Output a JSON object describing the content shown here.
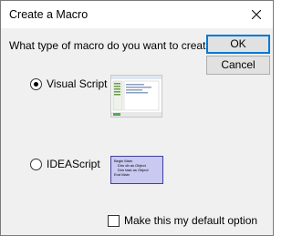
{
  "window": {
    "title": "Create a Macro"
  },
  "prompt": "What type of macro do you want to create?",
  "buttons": {
    "ok": "OK",
    "cancel": "Cancel"
  },
  "options": [
    {
      "label": "Visual Script",
      "selected": true
    },
    {
      "label": "IDEAScript",
      "selected": false
    }
  ],
  "ideascript_preview": [
    "Begin Main",
    "Dim db as Object",
    "Dim task as Object",
    "End Main"
  ],
  "default_option": {
    "label": "Make this my default option",
    "checked": false
  }
}
